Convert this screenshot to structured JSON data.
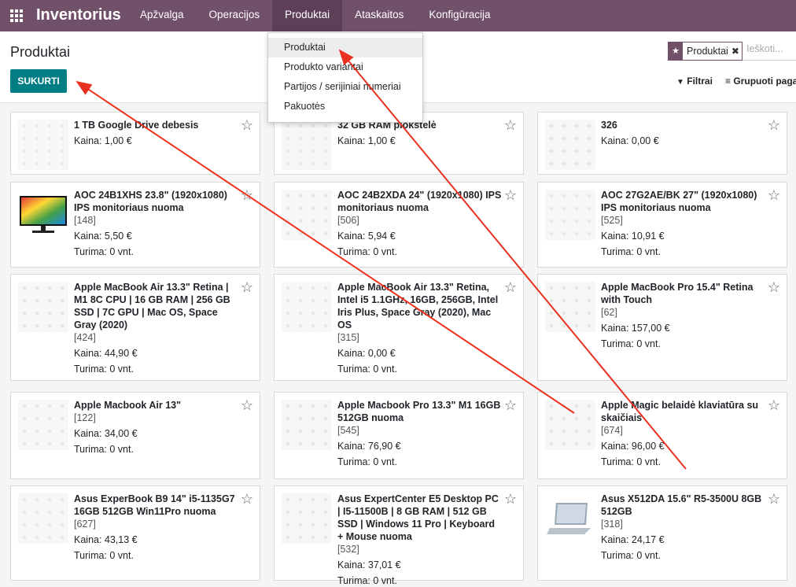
{
  "navbar": {
    "brand": "Inventorius",
    "menu": [
      "Apžvalga",
      "Operacijos",
      "Produktai",
      "Ataskaitos",
      "Konfigūracija"
    ]
  },
  "control_panel": {
    "title": "Produktai",
    "create_label": "SUKURTI",
    "facet": "Produktai",
    "search_placeholder": "Ieškoti...",
    "filters_label": "Filtrai",
    "groupby_label": "Grupuoti pagal"
  },
  "dropdown": [
    "Produktai",
    "Produkto variantai",
    "Partijos / serijiniai numeriai",
    "Pakuotės"
  ],
  "cards": [
    {
      "name": "1 TB Google Drive debesis",
      "ref": "",
      "price": "Kaina: 1,00 €",
      "stock": ""
    },
    {
      "name": "32 GB RAM plokštelė",
      "ref": "",
      "price": "Kaina: 1,00 €",
      "stock": ""
    },
    {
      "name": "326",
      "ref": "",
      "price": "Kaina: 0,00 €",
      "stock": ""
    },
    {
      "name": "AOC 24B1XHS 23.8\" (1920x1080) IPS monitoriaus nuoma",
      "ref": "[148]",
      "price": "Kaina: 5,50 €",
      "stock": "Turima: 0 vnt.",
      "image": "monitor"
    },
    {
      "name": "AOC 24B2XDA 24\" (1920x1080) IPS monitoriaus nuoma",
      "ref": "[506]",
      "price": "Kaina: 5,94 €",
      "stock": "Turima: 0 vnt."
    },
    {
      "name": "AOC 27G2AE/BK 27\" (1920x1080) IPS monitoriaus nuoma",
      "ref": "[525]",
      "price": "Kaina: 10,91 €",
      "stock": "Turima: 0 vnt."
    },
    {
      "name": "Apple MacBook Air 13.3\" Retina | M1 8C CPU | 16 GB RAM | 256 GB SSD | 7C GPU | Mac OS, Space Gray (2020)",
      "ref": "[424]",
      "price": "Kaina: 44,90 €",
      "stock": "Turima: 0 vnt."
    },
    {
      "name": "Apple MacBook Air 13.3\" Retina, Intel i5 1.1GHz, 16GB, 256GB, Intel Iris Plus, Space Gray (2020), Mac OS",
      "ref": "[315]",
      "price": "Kaina: 0,00 €",
      "stock": "Turima: 0 vnt."
    },
    {
      "name": "Apple MacBook Pro 15.4\" Retina with Touch",
      "ref": "[62]",
      "price": "Kaina: 157,00 €",
      "stock": "Turima: 0 vnt."
    },
    {
      "name": "Apple Macbook Air 13\"",
      "ref": "[122]",
      "price": "Kaina: 34,00 €",
      "stock": "Turima: 0 vnt."
    },
    {
      "name": "Apple Macbook Pro 13.3\" M1 16GB 512GB nuoma",
      "ref": "[545]",
      "price": "Kaina: 76,90 €",
      "stock": "Turima: 0 vnt."
    },
    {
      "name": "Apple Magic belaidė klaviatūra su skaičiais",
      "ref": "[674]",
      "price": "Kaina: 96,00 €",
      "stock": "Turima: 0 vnt."
    },
    {
      "name": "Asus ExperBook B9 14\" i5-1135G7 16GB 512GB Win11Pro nuoma",
      "ref": "[627]",
      "price": "Kaina: 43,13 €",
      "stock": "Turima: 0 vnt."
    },
    {
      "name": "Asus ExpertCenter E5 Desktop PC | I5-11500B | 8 GB RAM | 512 GB SSD | Windows 11 Pro | Keyboard + Mouse nuoma",
      "ref": "[532]",
      "price": "Kaina: 37,01 €",
      "stock": "Turima: 0 vnt."
    },
    {
      "name": "Asus X512DA 15.6\" R5-3500U 8GB 512GB",
      "ref": "[318]",
      "price": "Kaina: 24,17 €",
      "stock": "Turima: 0 vnt.",
      "image": "laptop"
    }
  ],
  "colors": {
    "navbar": "#71506a",
    "primary": "#017e84",
    "arrow": "#e8311f"
  }
}
